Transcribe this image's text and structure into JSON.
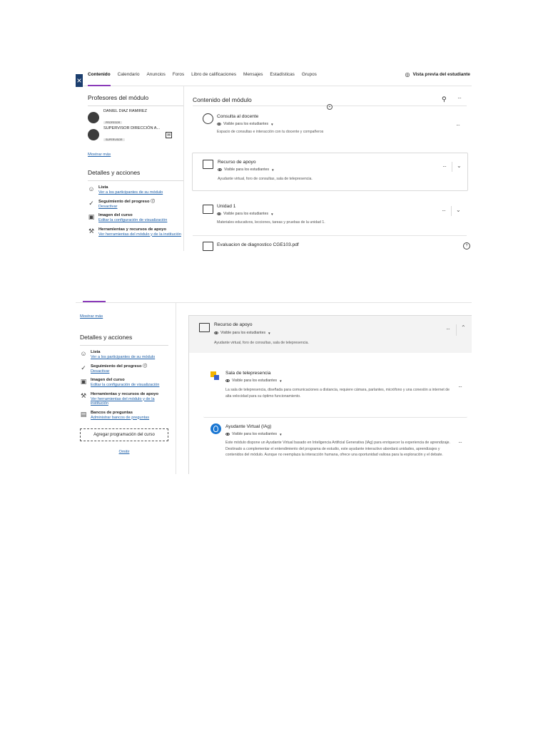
{
  "nav": {
    "tabs": [
      "Contenido",
      "Calendario",
      "Anuncios",
      "Foros",
      "Libro de calificaciones",
      "Mensajes",
      "Estadísticas",
      "Grupos"
    ],
    "preview_label": "Vista previa del estudiante"
  },
  "left": {
    "teachers_title": "Profesores del módulo",
    "teachers": [
      {
        "name": "DANIEL DIAZ RAMIREZ",
        "role": "PROFESOR"
      },
      {
        "name": "SUPERVISOR DIRECCIÓN A...",
        "role": "SUPERVISOR"
      }
    ],
    "show_more": "Mostrar más",
    "details_title": "Detalles y acciones",
    "actions": [
      {
        "title": "Lista",
        "link": "Ver a los participantes de su módulo"
      },
      {
        "title": "Seguimiento del progreso",
        "link": "Desactivar"
      },
      {
        "title": "Imagen del curso",
        "link": "Editar la configuración de visualización"
      },
      {
        "title": "Herramientas y recursos de apoyo",
        "link": "Ver herramientas del módulo y de la institución"
      },
      {
        "title": "Bancos de preguntas",
        "link": "Administrar bancos de preguntas"
      }
    ],
    "add_schedule": "Agregar programación del curso",
    "omit": "Omitir"
  },
  "content": {
    "title": "Contenido del módulo",
    "visibility": "Visible para los estudiantes",
    "items": [
      {
        "title": "Consulta al docente",
        "desc": "Espacio de consultas e interacción con tu docente y compañeros"
      },
      {
        "title": "Recurso de apoyo",
        "desc": "Ayudante virtual, foro de consultas, sala de telepresencia."
      },
      {
        "title": "Unidad 1",
        "desc": "Materiales educativos, lecciones, tareas y pruebas de la unidad 1."
      },
      {
        "title": "Evaluacion de diagnostico CGE103.pdf"
      }
    ],
    "sub_items": [
      {
        "title": "Sala de telepresencia",
        "desc": "La sala de telepresencia, diseñada para comunicaciones a distancia, requiere cámara, parlantes, micrófono y una conexión a internet de alta velocidad para su óptimo funcionamiento."
      },
      {
        "title": "Ayudante Virtual (IAg)",
        "desc": "Este módulo dispone un Ayudante Virtual basado en Inteligencia Artificial Generativa (IAg) para enriquecer la experiencia de aprendizaje. Destinado a complementar el entendimiento del programa de estudio, este ayudante interactivo abordará unidades, aprendizajes y contenidos del módulo. Aunque no reemplaza la interacción humana, ofrece una oportunidad valiosa para la exploración y el debate."
      }
    ]
  }
}
